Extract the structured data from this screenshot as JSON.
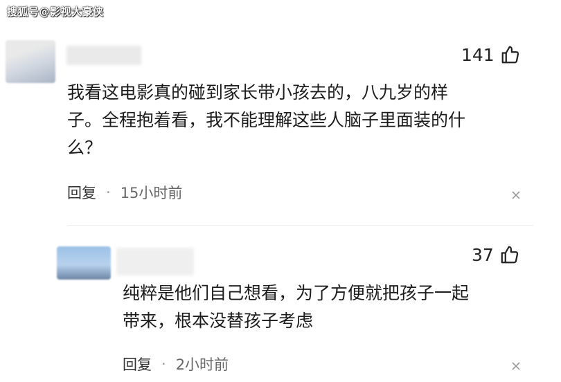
{
  "watermark": "搜狐号@影视大豪侠",
  "comments": [
    {
      "likes": "141",
      "text_lines": [
        "我看这电影真的碰到家长带小孩去的，八九岁的样",
        "子。全程抱着看，我不能理解这些人脑子里面装的什",
        "么？"
      ],
      "reply_label": "回复",
      "separator": "·",
      "time": "15小时前"
    },
    {
      "likes": "37",
      "text_lines": [
        "纯粹是他们自己想看，为了方便就把孩子一起",
        "带来，根本没替孩子考虑"
      ],
      "reply_label": "回复",
      "separator": "·",
      "time": "2小时前"
    }
  ],
  "icons": {
    "like": "thumbs-up-icon",
    "close": "close-icon"
  }
}
